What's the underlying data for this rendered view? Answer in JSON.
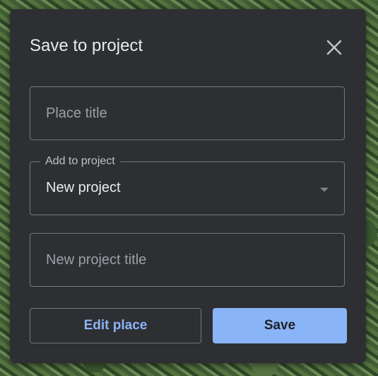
{
  "dialog": {
    "title": "Save to project",
    "close_icon": "close-icon",
    "place_title": {
      "value": "",
      "placeholder": "Place title"
    },
    "project_select": {
      "label": "Add to project",
      "selected": "New project",
      "icon": "dropdown-caret-icon"
    },
    "project_title": {
      "value": "",
      "placeholder": "New project title"
    },
    "edit_label": "Edit place",
    "save_label": "Save"
  },
  "colors": {
    "dialog_background": "#2e2f32",
    "text_primary": "#e8eaed",
    "placeholder": "#9aa0a6",
    "field_border": "#75777b",
    "accent_blue": "#8ab4f8",
    "save_text": "#202124"
  }
}
